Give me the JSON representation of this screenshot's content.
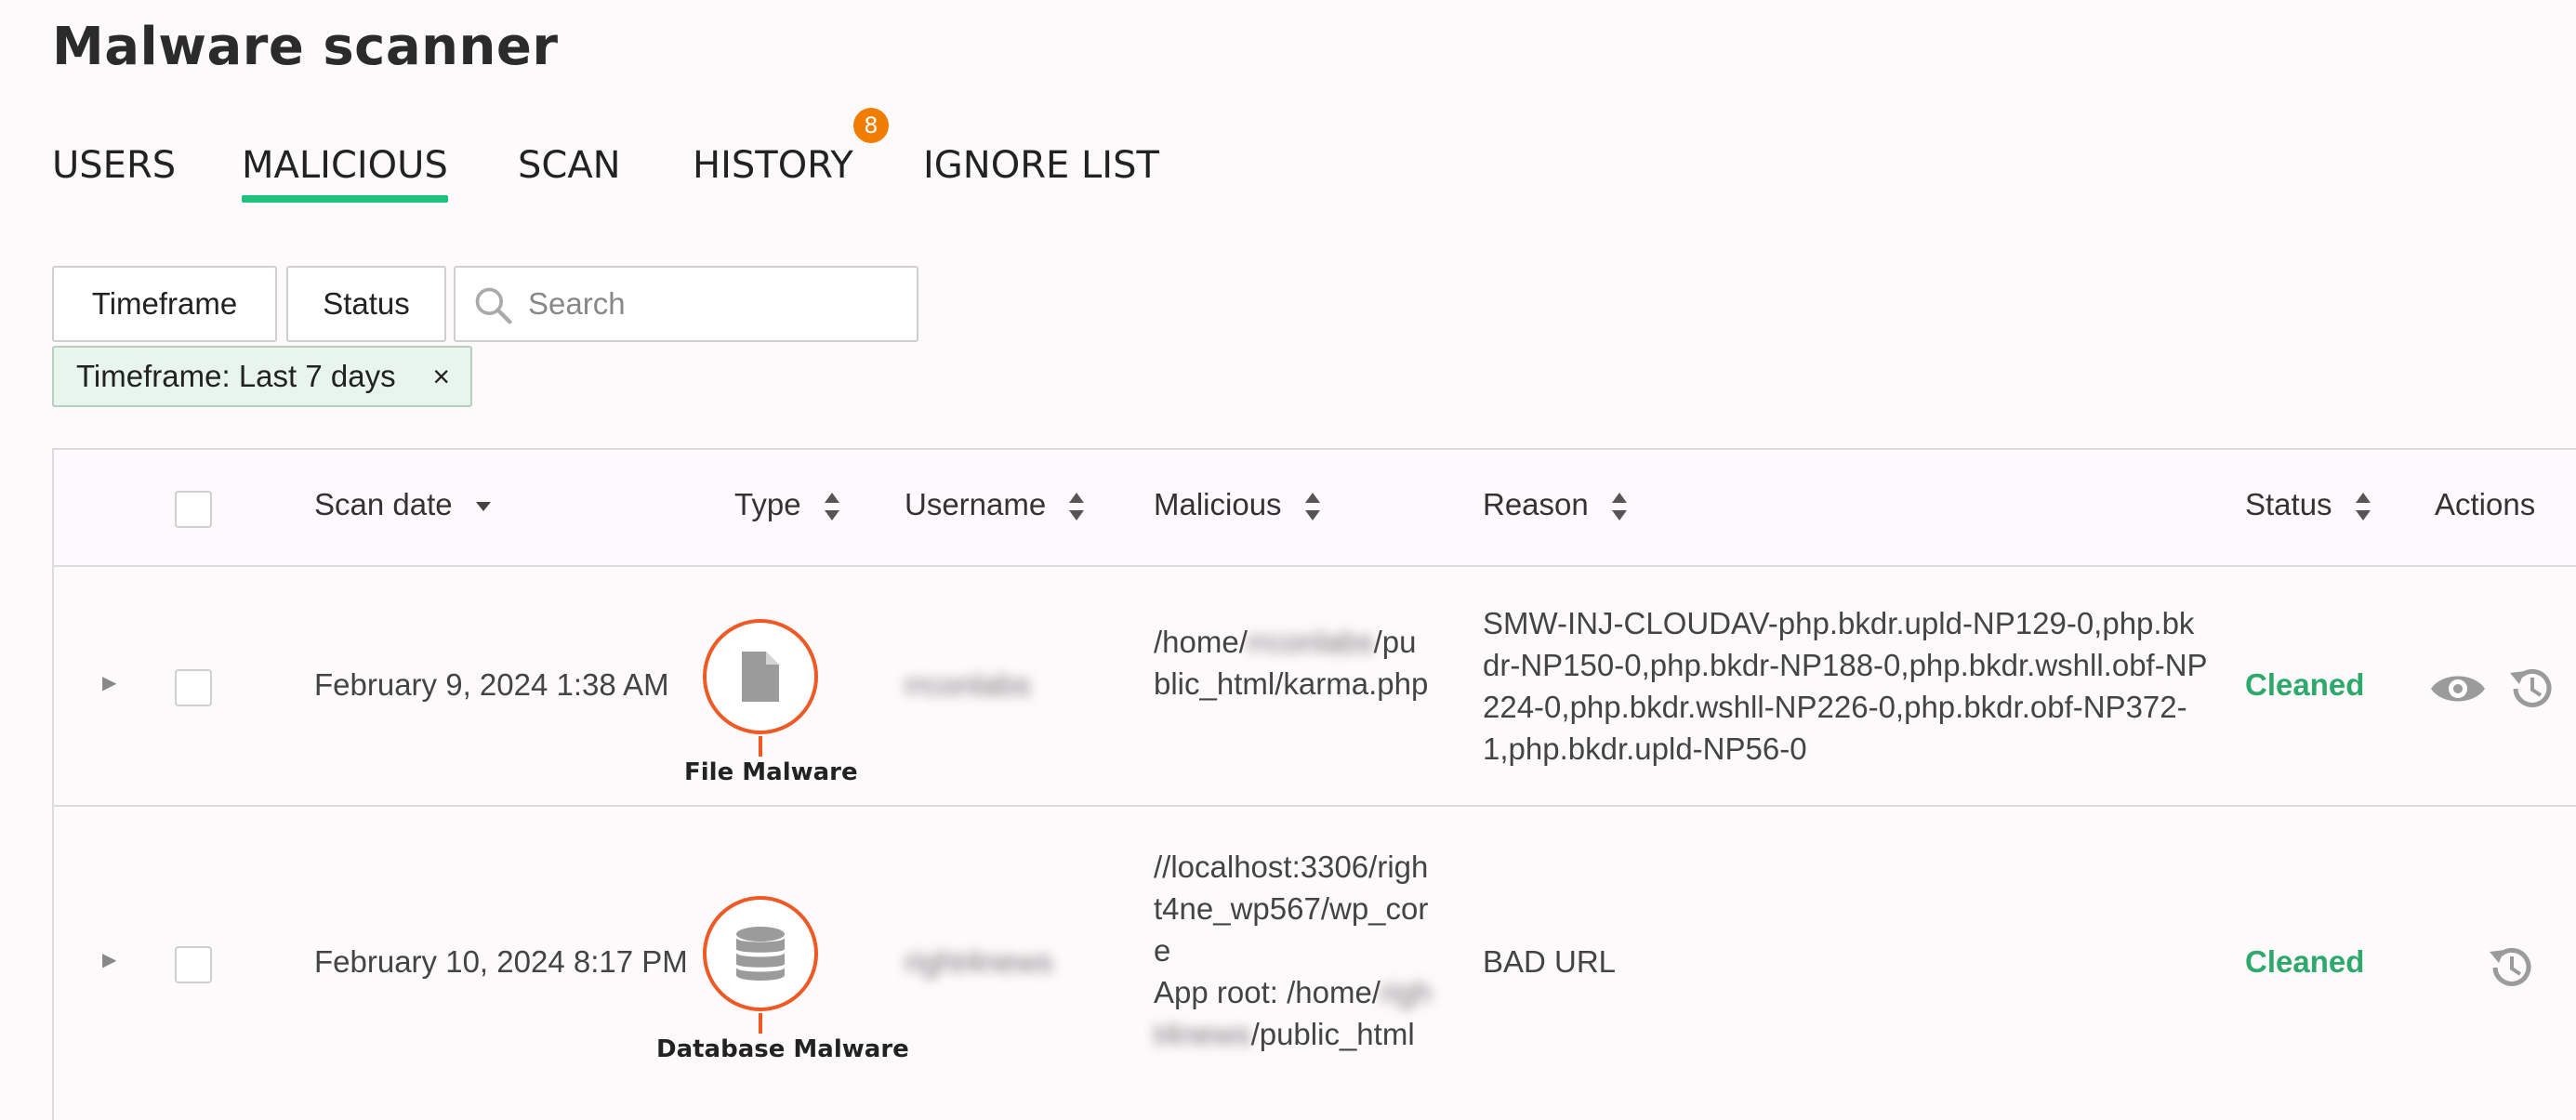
{
  "page": {
    "title": "Malware scanner"
  },
  "tabs": [
    {
      "label": "USERS",
      "active": false
    },
    {
      "label": "MALICIOUS",
      "active": true
    },
    {
      "label": "SCAN",
      "active": false
    },
    {
      "label": "HISTORY",
      "active": false,
      "badge": "8"
    },
    {
      "label": "IGNORE LIST",
      "active": false
    }
  ],
  "filters": {
    "timeframe_label": "Timeframe",
    "status_label": "Status",
    "search_placeholder": "Search",
    "active_chip": {
      "key": "Timeframe:",
      "value": "Last 7 days",
      "remove": "×"
    }
  },
  "table": {
    "columns": {
      "scan_date": "Scan date",
      "type": "Type",
      "username": "Username",
      "malicious": "Malicious",
      "reason": "Reason",
      "status": "Status",
      "actions": "Actions"
    },
    "rows": [
      {
        "scan_date": "February 9, 2024 1:38 AM",
        "type_icon": "file-icon",
        "type_label": "File Malware",
        "username": "rrconlabs",
        "malicious_parts": [
          "/home/",
          "rrconlabs",
          "/public_html/karma.php"
        ],
        "reason": "SMW-INJ-CLOUDAV-php.bkdr.upld-NP129-0,php.bkdr-NP150-0,php.bkdr-NP188-0,php.bkdr.wshll.obf-NP224-0,php.bkdr.wshll-NP226-0,php.bkdr.obf-NP372-1,php.bkdr.upld-NP56-0",
        "status": "Cleaned",
        "actions": [
          "eye-icon",
          "restore-history-icon"
        ]
      },
      {
        "scan_date": "February 10, 2024 8:17 PM",
        "type_icon": "database-icon",
        "type_label": "Database Malware",
        "username": "right4news",
        "malicious_parts": [
          "//localhost:3306/right4ne_wp567/wp_core",
          "App root: /home/",
          "right4news",
          "/public_html"
        ],
        "reason": "BAD URL",
        "status": "Cleaned",
        "actions": [
          "restore-history-icon"
        ]
      }
    ]
  },
  "colors": {
    "accent": "#1ec27e",
    "badge": "#f07c00",
    "type_ring": "#ef5a24",
    "status_ok": "#2ea96b"
  }
}
